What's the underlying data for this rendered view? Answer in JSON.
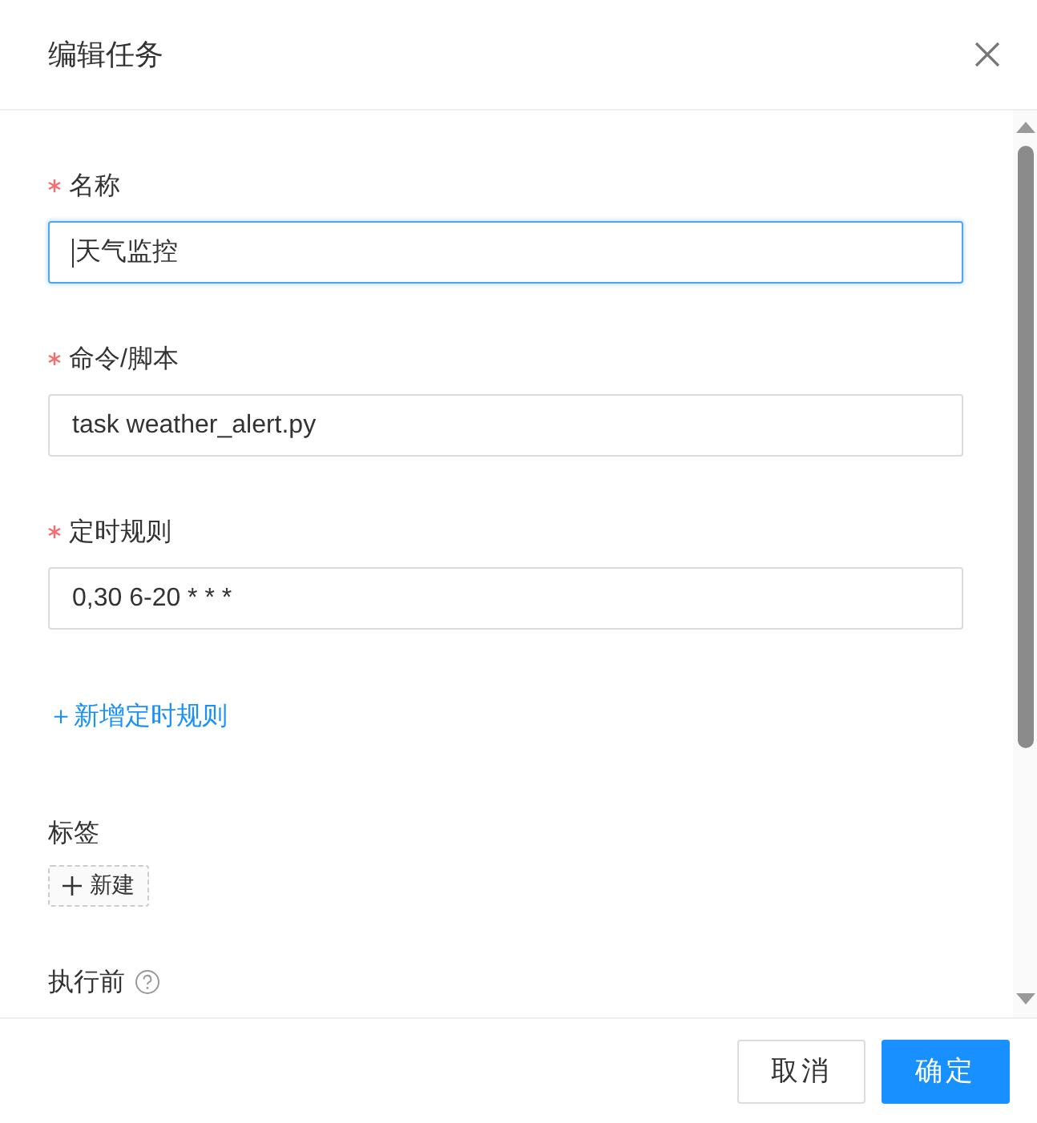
{
  "dialog": {
    "title": "编辑任务"
  },
  "fields": [
    {
      "kind": "input",
      "label": "名称",
      "required": true,
      "value": "天气监控",
      "focused": true
    },
    {
      "kind": "input",
      "label": "命令/脚本",
      "required": true,
      "value": "task weather_alert.py",
      "focused": false
    },
    {
      "kind": "input",
      "label": "定时规则",
      "required": true,
      "value": "0,30 6-20 * * *",
      "focused": false
    },
    {
      "kind": "link",
      "text": "＋新增定时规则"
    },
    {
      "kind": "tags",
      "label": "标签",
      "required": false,
      "button": "新建"
    },
    {
      "kind": "help",
      "label": "执行前",
      "required": false
    }
  ],
  "buttons": [
    {
      "label": "取消",
      "primary": false
    },
    {
      "label": "确定",
      "primary": true
    }
  ]
}
